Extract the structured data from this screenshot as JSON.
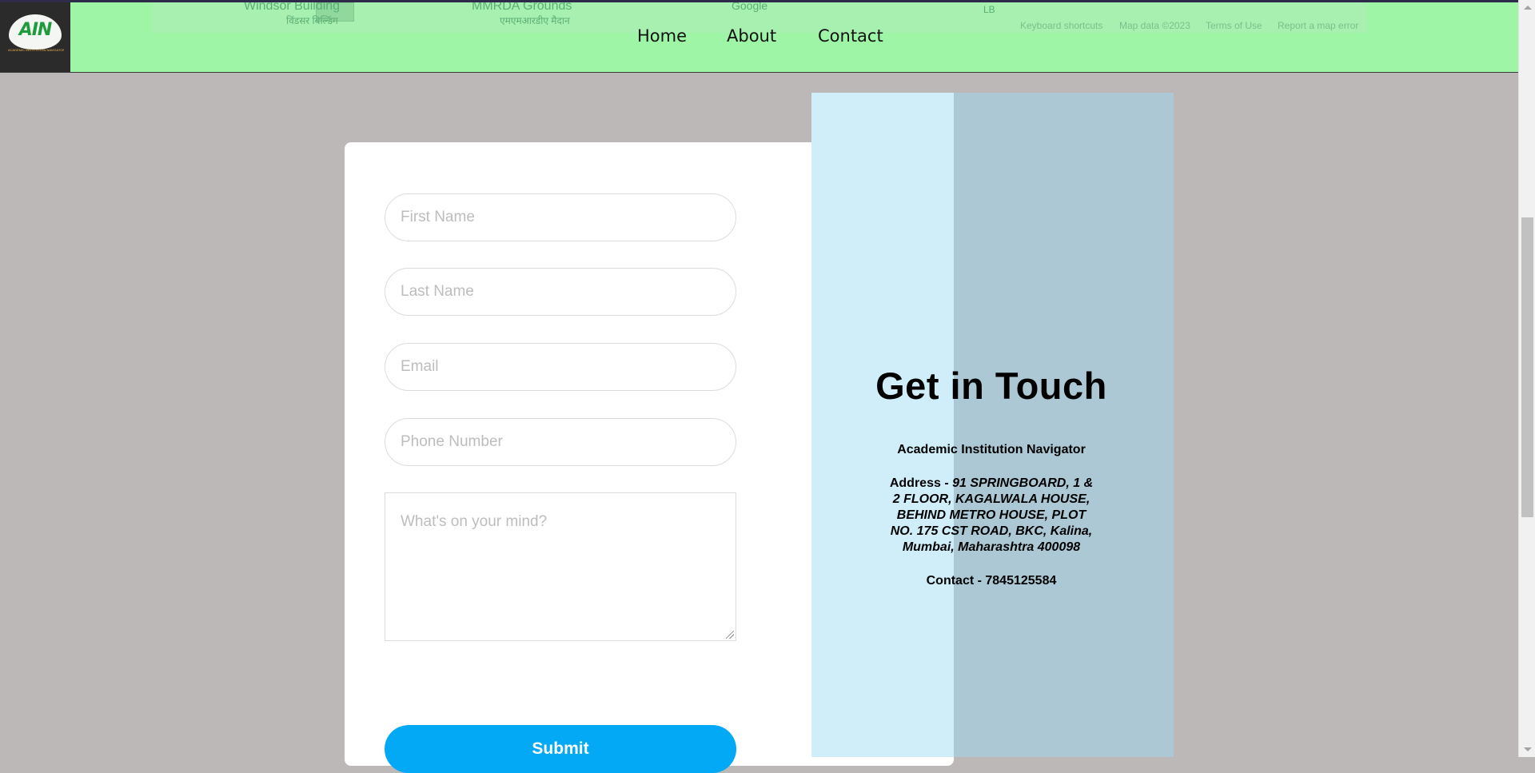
{
  "logo": {
    "text": "AIN",
    "subtitle": "ACADEMIC INSTITUTION NAVIGATOR"
  },
  "map": {
    "labels": [
      "Windsor Building",
      "विंडसर बिल्डिंग",
      "MMRDA Grounds",
      "एमएमआरडीए मैदान",
      "Google",
      "LB"
    ],
    "footer": [
      "Keyboard shortcuts",
      "Map data ©2023",
      "Terms of Use",
      "Report a map error"
    ]
  },
  "nav": {
    "home": "Home",
    "about": "About",
    "contact": "Contact"
  },
  "form": {
    "first_name_placeholder": "First Name",
    "last_name_placeholder": "Last Name",
    "email_placeholder": "Email",
    "phone_placeholder": "Phone Number",
    "message_placeholder": "What's on your mind?",
    "submit_label": "Submit"
  },
  "panel": {
    "title": "Get in Touch",
    "org": "Academic Institution Navigator",
    "address_label": "Address - ",
    "address": "91 SPRINGBOARD, 1 & 2 FLOOR, KAGALWALA HOUSE, BEHIND METRO HOUSE, PLOT NO. 175 CST ROAD, BKC, Kalina, Mumbai, Maharashtra 400098",
    "contact": "Contact - 7845125584"
  },
  "colors": {
    "header_bg": "#9ef5a6",
    "page_bg": "#bcb8b8",
    "submit_bg": "#03a9f4",
    "panel_light": "#cfeef9",
    "panel_dark": "#abc8d4"
  }
}
